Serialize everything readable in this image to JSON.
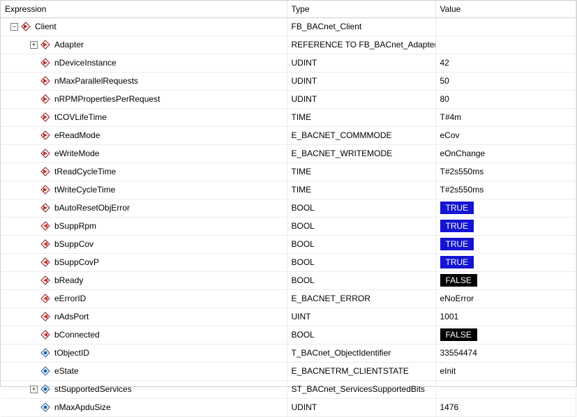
{
  "columns": {
    "expression": "Expression",
    "type": "Type",
    "value": "Value"
  },
  "rows": [
    {
      "indent": 0,
      "expander": "minus",
      "icon": "var-in",
      "name": "Client",
      "type": "FB_BACnet_Client",
      "value": ""
    },
    {
      "indent": 1,
      "expander": "plus",
      "icon": "var-in",
      "name": "Adapter",
      "type": "REFERENCE TO FB_BACnet_Adapter",
      "value": ""
    },
    {
      "indent": 1,
      "expander": "",
      "icon": "var-in",
      "name": "nDeviceInstance",
      "type": "UDINT",
      "value": "42"
    },
    {
      "indent": 1,
      "expander": "",
      "icon": "var-in",
      "name": "nMaxParallelRequests",
      "type": "UDINT",
      "value": "50"
    },
    {
      "indent": 1,
      "expander": "",
      "icon": "var-in",
      "name": "nRPMPropertiesPerRequest",
      "type": "UDINT",
      "value": "80"
    },
    {
      "indent": 1,
      "expander": "",
      "icon": "var-in",
      "name": "tCOVLifeTime",
      "type": "TIME",
      "value": "T#4m"
    },
    {
      "indent": 1,
      "expander": "",
      "icon": "var-in",
      "name": "eReadMode",
      "type": "E_BACNET_COMMMODE",
      "value": "eCov"
    },
    {
      "indent": 1,
      "expander": "",
      "icon": "var-in",
      "name": "eWriteMode",
      "type": "E_BACNET_WRITEMODE",
      "value": "eOnChange"
    },
    {
      "indent": 1,
      "expander": "",
      "icon": "var-in",
      "name": "tReadCycleTime",
      "type": "TIME",
      "value": "T#2s550ms"
    },
    {
      "indent": 1,
      "expander": "",
      "icon": "var-in",
      "name": "tWriteCycleTime",
      "type": "TIME",
      "value": "T#2s550ms"
    },
    {
      "indent": 1,
      "expander": "",
      "icon": "var-in",
      "name": "bAutoResetObjError",
      "type": "BOOL",
      "value": "TRUE",
      "valueStyle": "bool-true"
    },
    {
      "indent": 1,
      "expander": "",
      "icon": "var-out",
      "name": "bSuppRpm",
      "type": "BOOL",
      "value": "TRUE",
      "valueStyle": "bool-true"
    },
    {
      "indent": 1,
      "expander": "",
      "icon": "var-out",
      "name": "bSuppCov",
      "type": "BOOL",
      "value": "TRUE",
      "valueStyle": "bool-true"
    },
    {
      "indent": 1,
      "expander": "",
      "icon": "var-out",
      "name": "bSuppCovP",
      "type": "BOOL",
      "value": "TRUE",
      "valueStyle": "bool-true"
    },
    {
      "indent": 1,
      "expander": "",
      "icon": "var-out",
      "name": "bReady",
      "type": "BOOL",
      "value": "FALSE",
      "valueStyle": "bool-false"
    },
    {
      "indent": 1,
      "expander": "",
      "icon": "var-out",
      "name": "eErrorID",
      "type": "E_BACNET_ERROR",
      "value": "eNoError"
    },
    {
      "indent": 1,
      "expander": "",
      "icon": "var-out",
      "name": "nAdsPort",
      "type": "UINT",
      "value": "1001"
    },
    {
      "indent": 1,
      "expander": "",
      "icon": "var-out",
      "name": "bConnected",
      "type": "BOOL",
      "value": "FALSE",
      "valueStyle": "bool-false"
    },
    {
      "indent": 1,
      "expander": "",
      "icon": "var-int",
      "name": "tObjectID",
      "type": "T_BACnet_ObjectIdentifier",
      "value": "33554474"
    },
    {
      "indent": 1,
      "expander": "",
      "icon": "var-int",
      "name": "eState",
      "type": "E_BACNETRM_CLIENTSTATE",
      "value": "eInit"
    },
    {
      "indent": 1,
      "expander": "plus",
      "icon": "var-int",
      "name": "stSupportedServices",
      "type": "ST_BACnet_ServicesSupportedBits",
      "value": ""
    },
    {
      "indent": 1,
      "expander": "",
      "icon": "var-int",
      "name": "nMaxApduSize",
      "type": "UDINT",
      "value": "1476"
    }
  ]
}
